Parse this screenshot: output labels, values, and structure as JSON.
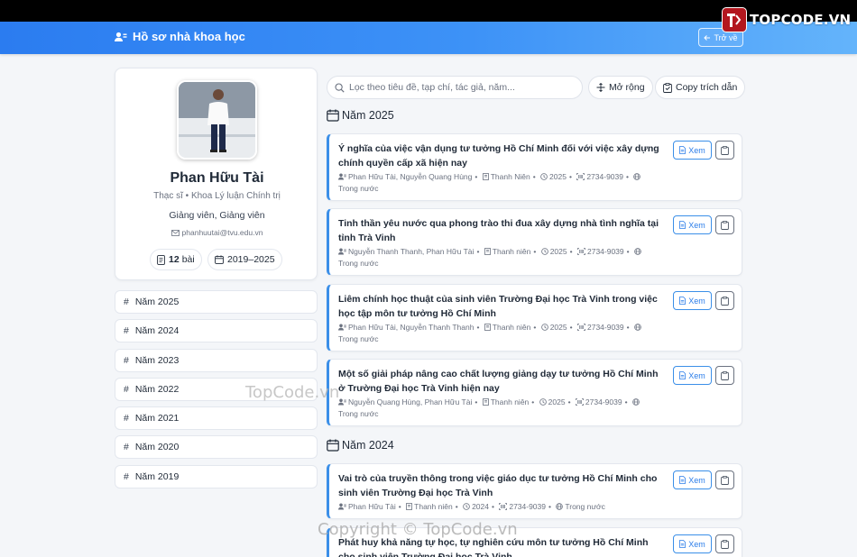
{
  "logo": {
    "text_a": "TOP",
    "text_b": "CODE",
    "text_c": ".VN"
  },
  "header": {
    "title": "Hồ sơ nhà khoa học",
    "back_label": "Trở về"
  },
  "profile": {
    "name": "Phan Hữu Tài",
    "degree": "Thạc sĩ • Khoa Lý luận Chính trị",
    "role": "Giảng viên, Giảng viên",
    "email": "phanhuutai@tvu.edu.vn",
    "count_value": "12",
    "count_unit": "bài",
    "years_range": "2019–2025"
  },
  "year_nav": [
    {
      "hash": "#",
      "label": "Năm 2025"
    },
    {
      "hash": "#",
      "label": "Năm 2024"
    },
    {
      "hash": "#",
      "label": "Năm 2023"
    },
    {
      "hash": "#",
      "label": "Năm 2022"
    },
    {
      "hash": "#",
      "label": "Năm 2021"
    },
    {
      "hash": "#",
      "label": "Năm 2020"
    },
    {
      "hash": "#",
      "label": "Năm 2019"
    }
  ],
  "toolbar": {
    "search_placeholder": "Lọc theo tiêu đề, tạp chí, tác giả, năm...",
    "expand_label": "Mở rộng",
    "copy_label": "Copy trích dẫn"
  },
  "sections": [
    {
      "year_label": "Năm 2025",
      "items": [
        {
          "title": "Ý nghĩa của việc vận dụng tư tưởng Hồ Chí Minh đối với việc xây dựng chính quyền cấp xã hiện nay",
          "authors": "Phan Hữu Tài, Nguyễn Quang Hùng",
          "journal": "Thanh Niên",
          "year": "2025",
          "issn": "2734-9039",
          "scope": "Trong nước",
          "view": "Xem"
        },
        {
          "title": "Tinh thần yêu nước qua phong trào thi đua xây dựng nhà tình nghĩa tại tỉnh Trà Vinh",
          "authors": "Nguyễn Thanh Thanh, Phan Hữu Tài",
          "journal": "Thanh niên",
          "year": "2025",
          "issn": "2734-9039",
          "scope": "Trong nước",
          "view": "Xem"
        },
        {
          "title": "Liêm chính học thuật của sinh viên Trường Đại học Trà Vinh trong việc học tập môn tư tưởng Hồ Chí Minh",
          "authors": "Phan Hữu Tài, Nguyễn Thanh Thanh",
          "journal": "Thanh niên",
          "year": "2025",
          "issn": "2734-9039",
          "scope": "Trong nước",
          "view": "Xem"
        },
        {
          "title": "Một số giải pháp nâng cao chất lượng giảng dạy tư tưởng Hồ Chí Minh ở Trường Đại học Trà Vinh hiện nay",
          "authors": "Nguyễn Quang Hùng, Phan Hữu Tài",
          "journal": "Thanh niên",
          "year": "2025",
          "issn": "2734-9039",
          "scope": "Trong nước",
          "view": "Xem"
        }
      ]
    },
    {
      "year_label": "Năm 2024",
      "items": [
        {
          "title": "Vai trò của truyền thông trong việc giáo dục tư tưởng Hồ Chí Minh cho sinh viên Trường Đại học Trà Vinh",
          "authors": "Phan Hữu Tài",
          "journal": "Thanh niên",
          "year": "2024",
          "issn": "2734-9039",
          "scope": "Trong nước",
          "view": "Xem"
        },
        {
          "title": "Phát huy khả năng tự học, tự nghiên cứu môn tư tưởng Hồ Chí Minh cho sinh viên Trường Đại học Trà Vinh",
          "view": "Xem"
        }
      ]
    }
  ],
  "watermarks": {
    "mid": "TopCode.vn",
    "bottom": "Copyright © TopCode.vn"
  },
  "colors": {
    "header_start": "#2b7cf0",
    "header_end": "#64b4fb",
    "accent": "#3b8fe8",
    "background": "#f4f6f9"
  }
}
